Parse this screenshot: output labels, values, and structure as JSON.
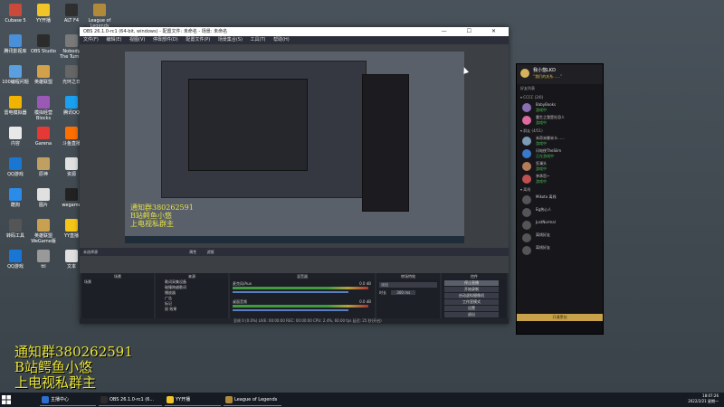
{
  "desktop": {
    "icons": [
      {
        "label": "Cubase 5",
        "color": "#c94a3a"
      },
      {
        "label": "YY开播",
        "color": "#f1c428"
      },
      {
        "label": "ALT F4",
        "color": "#2f2f2f"
      },
      {
        "label": "League of Legends",
        "color": "#b08a3a"
      },
      {
        "label": "腾讯影视库",
        "color": "#4a90d9"
      },
      {
        "label": "OBS Studio",
        "color": "#2c2c2c"
      },
      {
        "label": "Nobody The Turnip",
        "color": "#7a7a7a"
      },
      {
        "label": "TGP",
        "color": "#3b3b6b"
      },
      {
        "label": "100编程问题",
        "color": "#5aa0e0"
      },
      {
        "label": "英雄联盟",
        "color": "#d3a14a"
      },
      {
        "label": "光环之日",
        "color": "#666"
      },
      {
        "label": "GeForce Experience",
        "color": "#76b900"
      },
      {
        "label": "雷电模拟器",
        "color": "#f0b400"
      },
      {
        "label": "模拟经营 Blocks",
        "color": "#9b59b6"
      },
      {
        "label": "腾讯QQ",
        "color": "#1aa0f0"
      },
      {
        "label": "电脑管家",
        "color": "#1e88e5"
      },
      {
        "label": "内容",
        "color": "#e8e8e8"
      },
      {
        "label": "Garena",
        "color": "#e53935"
      },
      {
        "label": "斗鱼直播",
        "color": "#ff6f00"
      },
      {
        "label": "口袋",
        "color": "#e0e0e0"
      },
      {
        "label": "QQ游戏",
        "color": "#1976d2"
      },
      {
        "label": "原神",
        "color": "#c0a060"
      },
      {
        "label": "资源",
        "color": "#e0e0e0"
      },
      {
        "label": "CD盘",
        "color": "#8e8e8e"
      },
      {
        "label": "酷狗",
        "color": "#2b8be8"
      },
      {
        "label": "图片",
        "color": "#e0e0e0"
      },
      {
        "label": "wegame",
        "color": "#222"
      },
      {
        "label": "剪映专业版",
        "color": "#111"
      },
      {
        "label": "转码工具",
        "color": "#555"
      },
      {
        "label": "英雄联盟 WeGame版",
        "color": "#c9a050"
      },
      {
        "label": "YY直播",
        "color": "#f5c518"
      },
      {
        "label": "回收站",
        "color": "#e0e0e0"
      },
      {
        "label": "QQ游戏",
        "color": "#1976d2"
      },
      {
        "label": "ttl",
        "color": "#999"
      },
      {
        "label": "文本",
        "color": "#e0e0e0"
      }
    ]
  },
  "obs": {
    "title": "OBS 26.1.0-rc1 (64-bit, windows) - 配置文件: 未命名 - 场景: 未命名",
    "win_btns": "— ☐ ✕",
    "menu": [
      "文件(F)",
      "编辑(E)",
      "视图(V)",
      "停靠部件(D)",
      "配置文件(P)",
      "场景集合(S)",
      "工具(T)",
      "帮助(H)"
    ],
    "preview_overlay": [
      "通知群380262591",
      "B站鳄鱼小悠",
      "上电视私群主"
    ],
    "source_name_bar": "未选择源",
    "props_btn": "属性",
    "filter_btn": "滤镜",
    "docks": {
      "scenes": {
        "title": "场景",
        "items": [
          "场景"
        ]
      },
      "sources": {
        "title": "来源",
        "items": [
          "歌词采集设备",
          "碰撞跨越歌词",
          "播放器",
          "广告",
          "标记",
          "鼠 效果"
        ]
      },
      "mixer": {
        "title": "混音器",
        "channels": [
          {
            "name": "麦克风/Aux",
            "db": "0.0 dB"
          },
          {
            "name": "桌面音频",
            "db": "0.0 dB"
          }
        ]
      },
      "transitions": {
        "title": "转场特效",
        "type": "淡出",
        "duration_label": "时长",
        "duration": "300 ms"
      },
      "controls": {
        "title": "控件",
        "buttons": [
          "停止直播",
          "开始录制",
          "启动虚拟摄像机",
          "工作室模式",
          "设置",
          "退出"
        ]
      }
    },
    "status": "丢帧 0 (0.0%)    LIVE: 00:00:00    REC: 00:00:00    CPU: 2.4%, 60.00 fps    延迟: 25 秒(开启)"
  },
  "chat": {
    "username": "我小悠LKD",
    "signature": "“我们的关系……”",
    "friends_label": "好友列表",
    "groups": [
      {
        "name": "CCCC (2/6)",
        "items": [
          {
            "name": "BabyBooks",
            "status": "游戏中",
            "color": "#8a6fb5"
          },
          {
            "name": "重生之我是社恐人",
            "status": "游戏中",
            "color": "#e06aa0"
          }
        ]
      },
      {
        "name": "群友 (4/51)",
        "items": [
          {
            "name": "米奇米娜米卡……",
            "status": "游戏中",
            "color": "#7c9cb5"
          },
          {
            "name": "闪电侠TheSlim",
            "status": "正在游戏中",
            "color": "#3a79c9"
          },
          {
            "name": "狂澜头",
            "status": "游戏中",
            "color": "#b57c5a"
          },
          {
            "name": "李承哲~",
            "status": "游戏中",
            "color": "#c05050"
          }
        ]
      },
      {
        "name": "离线",
        "items": [
          {
            "name": "Mikoto 离线",
            "status": "",
            "color": "#555"
          },
          {
            "name": "Eg热心人",
            "status": "",
            "color": "#555"
          },
          {
            "name": "JustNormal",
            "status": "",
            "color": "#555"
          },
          {
            "name": "离线好友",
            "status": "",
            "color": "#555"
          },
          {
            "name": "离线好友",
            "status": "",
            "color": "#555"
          }
        ]
      }
    ],
    "vip_bar": "开通黑钻"
  },
  "overlay": {
    "lines": [
      "通知群380262591",
      "B站鳄鱼小悠",
      "上电视私群主"
    ]
  },
  "taskbar": {
    "items": [
      {
        "label": "主播中心",
        "color": "#2b6fd1"
      },
      {
        "label": "OBS 26.1.0-rc1 (6...",
        "color": "#2c2c2c"
      },
      {
        "label": "YY开播",
        "color": "#f1c428"
      },
      {
        "label": "League of Legends",
        "color": "#b08a3a"
      }
    ],
    "time": "18:07:26",
    "date": "2022/2/21 星期一"
  }
}
